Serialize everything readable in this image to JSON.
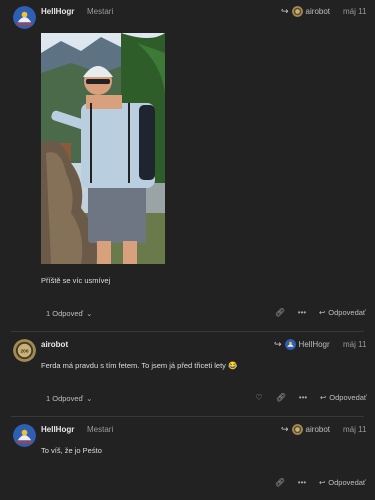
{
  "colors": {
    "background": "#222222",
    "text": "#dddddd",
    "muted": "#9a9a9a",
    "separator": "#383838"
  },
  "posts": [
    {
      "username": "HellHogr",
      "user_title": "Mestari",
      "reply_to": "airobot",
      "date": "máj 11",
      "body": "Příště se víc usmívej",
      "replies": "1 Odpoveď",
      "reply_label": "Odpovedať",
      "icons": [
        "link-icon",
        "more-icon",
        "reply-icon"
      ]
    },
    {
      "username": "airobot",
      "user_title": "",
      "reply_to": "HellHogr",
      "date": "máj 11",
      "body": "Ferda má pravdu s tím fetem. To jsem já před třiceti lety 😂",
      "replies": "1 Odpoveď",
      "reply_label": "Odpovedať",
      "icons": [
        "heart-icon",
        "link-icon",
        "more-icon",
        "reply-icon"
      ]
    },
    {
      "username": "HellHogr",
      "user_title": "Mestari",
      "reply_to": "airobot",
      "date": "máj 11",
      "body": "To víš, že jo Peśto",
      "replies": "",
      "reply_label": "Odpovedať",
      "icons": [
        "link-icon",
        "more-icon",
        "reply-icon"
      ]
    }
  ]
}
